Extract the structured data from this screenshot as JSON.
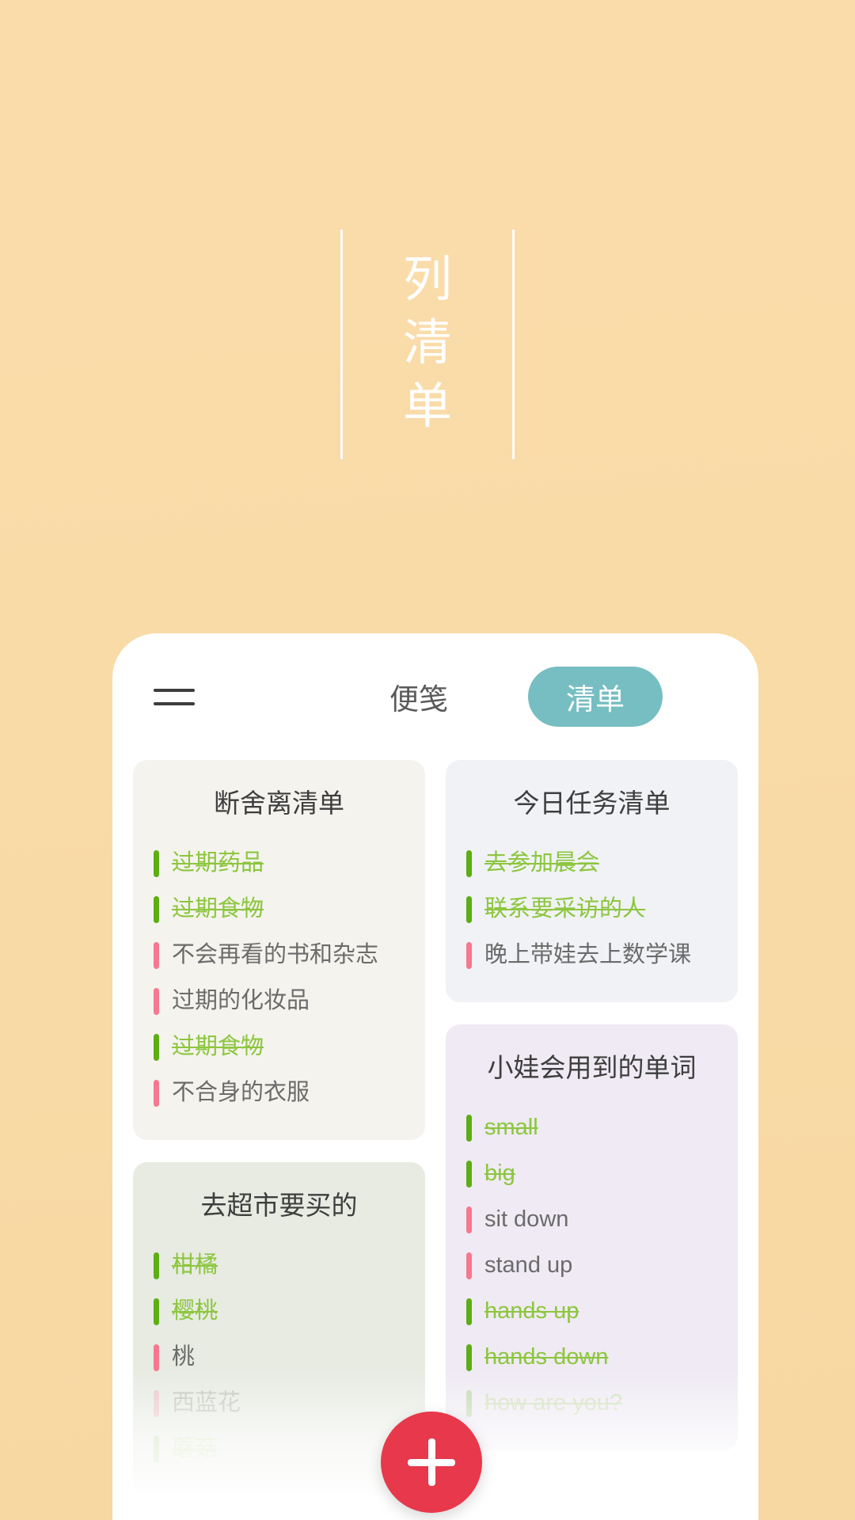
{
  "app": {
    "background_color": "#F9DBA8",
    "accent_teal": "#76BEC2",
    "accent_red": "#E8384B",
    "done_color": "#8DC63F",
    "todo_color": "#6B6B6B",
    "done_bar_color": "#5CAE12",
    "todo_bar_color": "#F5788F"
  },
  "hero": {
    "title_chars": [
      "列",
      "清",
      "单"
    ],
    "title_text": "列清单"
  },
  "topbar": {
    "menu_icon": "hamburger-menu-icon",
    "tabs": [
      {
        "label": "便笺",
        "active": false
      },
      {
        "label": "清单",
        "active": true
      }
    ]
  },
  "fab": {
    "icon": "plus-icon",
    "label": "+"
  },
  "board": {
    "left_column": [
      {
        "title": "断舍离清单",
        "background": "#F4F3EE",
        "items": [
          {
            "text": "过期药品",
            "done": true,
            "faded": false
          },
          {
            "text": "过期食物",
            "done": true,
            "faded": false
          },
          {
            "text": "不会再看的书和杂志",
            "done": false,
            "faded": false
          },
          {
            "text": "过期的化妆品",
            "done": false,
            "faded": false
          },
          {
            "text": "过期食物",
            "done": true,
            "faded": false
          },
          {
            "text": "不合身的衣服",
            "done": false,
            "faded": false
          }
        ]
      },
      {
        "title": "去超市要买的",
        "background": "#E7EBE2",
        "items": [
          {
            "text": "柑橘",
            "done": true,
            "faded": false
          },
          {
            "text": "樱桃",
            "done": true,
            "faded": false
          },
          {
            "text": "桃",
            "done": false,
            "faded": false
          },
          {
            "text": "西蓝花",
            "done": false,
            "faded": true
          },
          {
            "text": "蘑菇",
            "done": true,
            "faded": true
          }
        ]
      }
    ],
    "right_column": [
      {
        "title": "今日任务清单",
        "background": "#F0F2F5",
        "items": [
          {
            "text": "去参加晨会",
            "done": true,
            "faded": false
          },
          {
            "text": "联系要采访的人",
            "done": true,
            "faded": false
          },
          {
            "text": "晚上带娃去上数学课",
            "done": false,
            "faded": false
          }
        ]
      },
      {
        "title": "小娃会用到的单词",
        "background": "#EFEAF3",
        "items": [
          {
            "text": "small",
            "done": true,
            "faded": false
          },
          {
            "text": "big",
            "done": true,
            "faded": false
          },
          {
            "text": "sit down",
            "done": false,
            "faded": false
          },
          {
            "text": "stand up",
            "done": false,
            "faded": false
          },
          {
            "text": "hands up",
            "done": true,
            "faded": false
          },
          {
            "text": "hands down",
            "done": true,
            "faded": false
          },
          {
            "text": "how are you?",
            "done": true,
            "faded": true
          }
        ]
      }
    ]
  }
}
